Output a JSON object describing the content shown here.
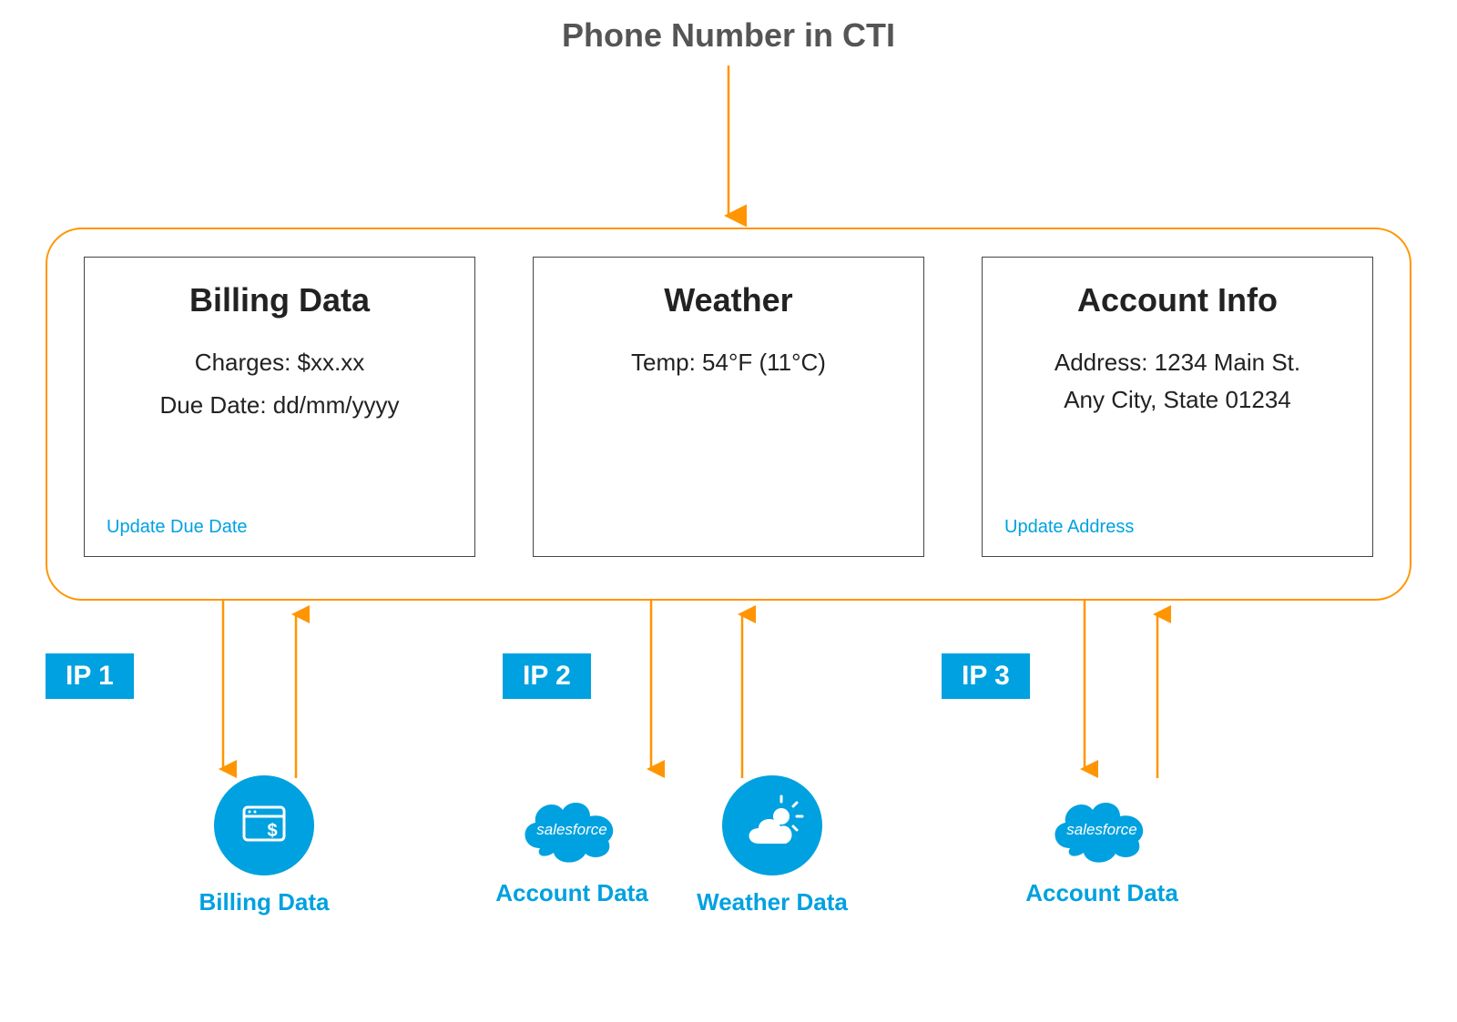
{
  "top_label": "Phone Number in CTI",
  "cards": {
    "billing": {
      "title": "Billing Data",
      "line1": "Charges: $xx.xx",
      "line2": "Due Date: dd/mm/yyyy",
      "link": "Update Due Date"
    },
    "weather": {
      "title": "Weather",
      "line1": "Temp: 54°F (11°C)"
    },
    "account": {
      "title": "Account Info",
      "line1": "Address: 1234 Main St.",
      "line2": "Any City, State 01234",
      "link": "Update Address"
    }
  },
  "ips": {
    "ip1": "IP 1",
    "ip2": "IP 2",
    "ip3": "IP 3"
  },
  "sources": {
    "billing": "Billing Data",
    "account": "Account Data",
    "weather": "Weather Data"
  },
  "colors": {
    "accent": "#00a1e0",
    "orange": "#ff9500"
  },
  "brand": {
    "salesforce": "salesforce"
  }
}
